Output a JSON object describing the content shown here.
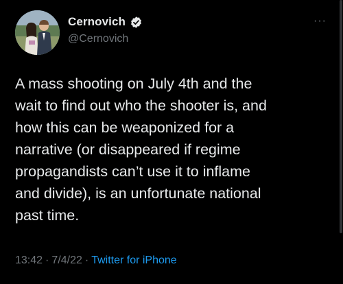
{
  "tweet": {
    "display_name": "Cernovich",
    "handle": "@Cernovich",
    "more_label": "···",
    "text": "A mass shooting on July 4th and the\nwait to find out who the shooter is, and\nhow this can be weaponized for a\nnarrative (or disappeared if regime\npropagandists can’t use it to inflame\nand divide), is an unfortunate national\npast time.",
    "time": "13:42",
    "separator": "·",
    "date": "7/4/22",
    "source": "Twitter for iPhone"
  },
  "colors": {
    "background": "#000000",
    "text_primary": "#e7e9ea",
    "text_secondary": "#71767b",
    "accent": "#1d9bf0"
  }
}
